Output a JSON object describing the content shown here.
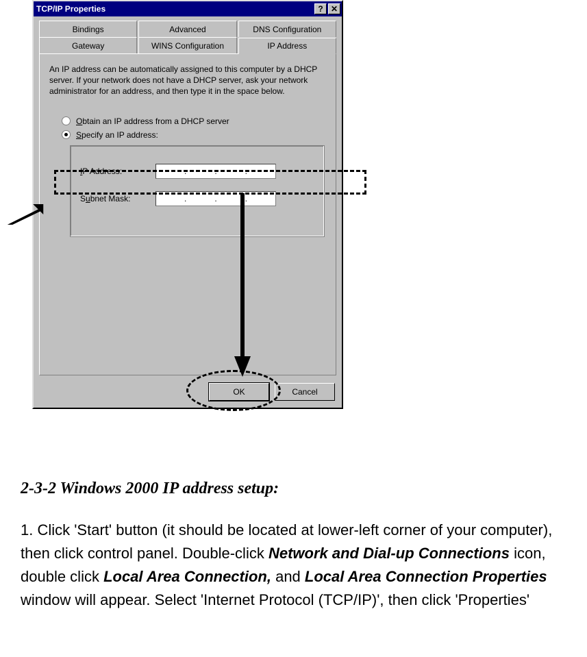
{
  "dialog": {
    "title": "TCP/IP Properties",
    "help_glyph": "?",
    "close_glyph": "✕",
    "tabs_back": [
      "Bindings",
      "Advanced",
      "DNS Configuration"
    ],
    "tabs_front": [
      "Gateway",
      "WINS Configuration",
      "IP Address"
    ],
    "active_tab_index": 2,
    "description": "An IP address can be automatically assigned to this computer by a DHCP server. If your network does not have a DHCP server, ask your network administrator for an address, and then type it in the space below.",
    "radio_obtain_pre": "O",
    "radio_obtain_rest": "btain an IP address from a DHCP server",
    "radio_specify_pre": "S",
    "radio_specify_rest": "pecify an IP address:",
    "ip_label_pre": "I",
    "ip_label_rest": "P Address:",
    "subnet_label_pre": "S",
    "subnet_label_u": "u",
    "subnet_label_rest": "bnet Mask:",
    "ip_dots": [
      ".",
      ".",
      "."
    ],
    "ok_label": "OK",
    "cancel_label": "Cancel"
  },
  "article": {
    "heading": "2-3-2 Windows 2000 IP address setup:",
    "p1a": "1. Click 'Start' button (it should be located at lower-left corner of your computer), then click control panel. Double-click ",
    "p1b": "Network and Dial-up Connections",
    "p1c": " icon, double click ",
    "p1d": "Local Area Connection,",
    "p1e": " and ",
    "p1f": "Local Area Connection Properties",
    "p1g": " window will appear. Select 'Internet Protocol (TCP/IP)', then click 'Properties'"
  }
}
